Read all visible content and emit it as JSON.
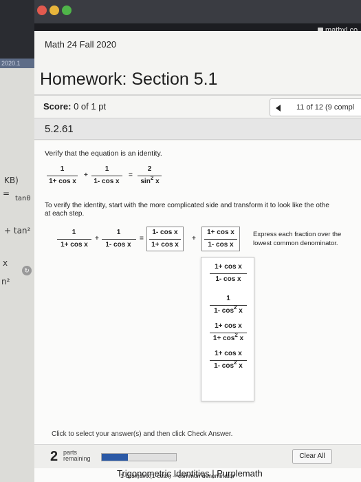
{
  "browser": {
    "url": "mathxl.co"
  },
  "background_sheet": {
    "year": "2020.1",
    "notes": [
      "KB)",
      "=",
      "tanθ",
      "+ tan²",
      "x",
      "n²"
    ]
  },
  "course": {
    "title": "Math 24 Fall 2020"
  },
  "page": {
    "title": "Homework: Section 5.1"
  },
  "score": {
    "label": "Score:",
    "value": "0 of 1 pt"
  },
  "navigator": {
    "text": "11 of 12 (9 compl"
  },
  "question": {
    "number": "5.2.61",
    "instruction": "Verify that the equation is an identity.",
    "identity": {
      "term1_num": "1",
      "term1_den": "1+ cos x",
      "term2_num": "1",
      "term2_den": "1- cos x",
      "rhs_num": "2",
      "rhs_den": "sin",
      "rhs_exp": "2",
      "rhs_var": "x",
      "plus": "+",
      "equals": "="
    },
    "step_text_1": "To verify the identity, start with the more complicated side and transform it to look like the othe",
    "step_text_2": "at each step.",
    "step": {
      "term1_num": "1",
      "term1_den": "1+ cos x",
      "term2_num": "1",
      "term2_den": "1- cos x",
      "box1_num": "1- cos x",
      "box1_den": "1+ cos x",
      "box2_num": "1+ cos x",
      "box2_den": "1- cos x",
      "plus": "+",
      "equals": "=",
      "hint_1": "Express each fraction over the",
      "hint_2": "lowest common denominator."
    },
    "dropdown_options": [
      {
        "num": "1+ cos x",
        "den": "1- cos x",
        "exp": ""
      },
      {
        "num": "1",
        "den": "1- cos",
        "exp": "2",
        "var": "x"
      },
      {
        "num": "1+ cos x",
        "den": "1+ cos",
        "exp": "2",
        "var": "x"
      },
      {
        "num": "1+ cos x",
        "den": "1- cos",
        "exp": "2",
        "var": "x"
      }
    ]
  },
  "footer": {
    "click_instruction": "Click to select your answer(s) and then click Check Answer.",
    "parts_number": "2",
    "parts_label_1": "parts",
    "parts_label_2": "remaining",
    "progress_fraction": 0.35,
    "clear_all": "Clear All",
    "lower_text": "1-cosx)sinx(1-cosx) ->common denominator",
    "resource_title": "Trigonometric Identities | Purplemath"
  },
  "colors": {
    "progress": "#2b59a6",
    "window_bg": "#f4f4f2"
  }
}
